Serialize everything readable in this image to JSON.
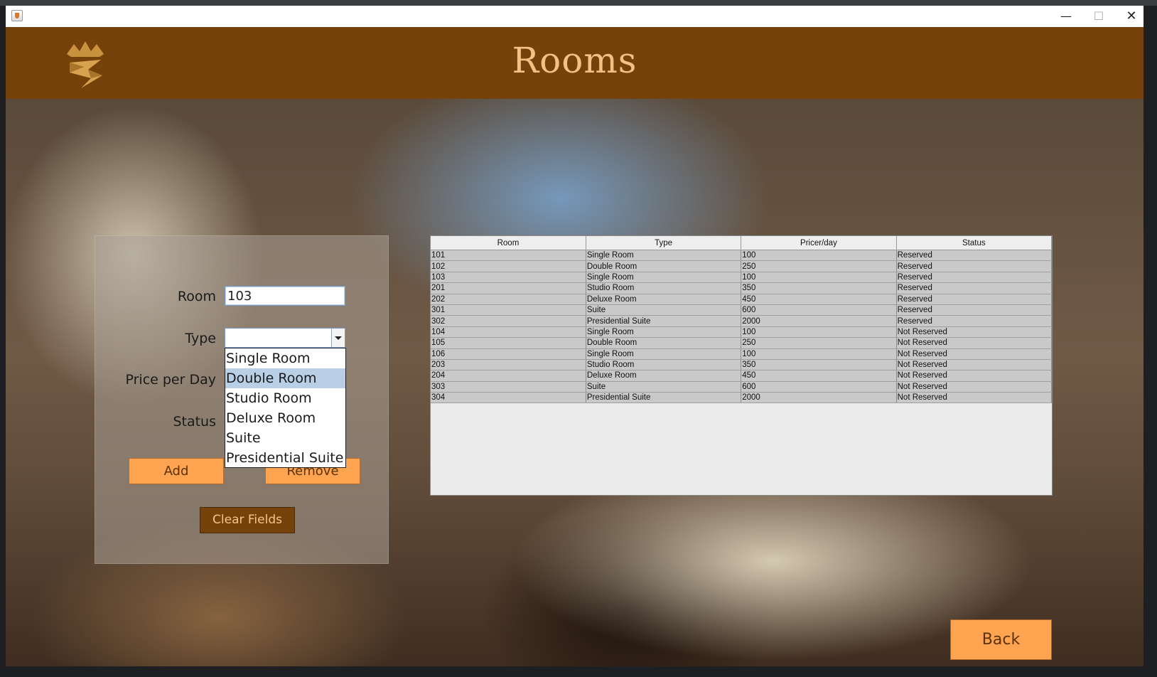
{
  "page_title": "Rooms",
  "form": {
    "room_label": "Room",
    "type_label": "Type",
    "price_label": "Price per Day",
    "status_label": "Status",
    "room_value": "103",
    "type_value": "",
    "type_options": [
      "Single Room",
      "Double Room",
      "Studio Room",
      "Deluxe Room",
      "Suite",
      "Presidential Suite"
    ],
    "highlighted_option": "Double Room",
    "add_label": "Add",
    "remove_label": "Remove",
    "clear_label": "Clear Fields"
  },
  "table": {
    "columns": [
      "Room",
      "Type",
      "Pricer/day",
      "Status"
    ],
    "rows": [
      [
        "101",
        "Single Room",
        "100",
        "Reserved"
      ],
      [
        "102",
        "Double Room",
        "250",
        "Reserved"
      ],
      [
        "103",
        "Single Room",
        "100",
        "Reserved"
      ],
      [
        "201",
        "Studio Room",
        "350",
        "Reserved"
      ],
      [
        "202",
        "Deluxe Room",
        "450",
        "Reserved"
      ],
      [
        "301",
        "Suite",
        "600",
        "Reserved"
      ],
      [
        "302",
        "Presidential Suite",
        "2000",
        "Reserved"
      ],
      [
        "104",
        "Single Room",
        "100",
        "Not Reserved"
      ],
      [
        "105",
        "Double Room",
        "250",
        "Not Reserved"
      ],
      [
        "106",
        "Single Room",
        "100",
        "Not Reserved"
      ],
      [
        "203",
        "Studio Room",
        "350",
        "Not Reserved"
      ],
      [
        "204",
        "Deluxe Room",
        "450",
        "Not Reserved"
      ],
      [
        "303",
        "Suite",
        "600",
        "Not Reserved"
      ],
      [
        "304",
        "Presidential Suite",
        "2000",
        "Not Reserved"
      ]
    ]
  },
  "back_label": "Back",
  "window_controls": {
    "minimize": "—",
    "maximize": "☐",
    "close": "✕"
  },
  "colors": {
    "header": "#76420c",
    "title": "#f4c083",
    "button": "#ffa552",
    "button_dark": "#76420c"
  },
  "icons": {
    "app": "java-app-icon",
    "logo": "crown-logo"
  }
}
